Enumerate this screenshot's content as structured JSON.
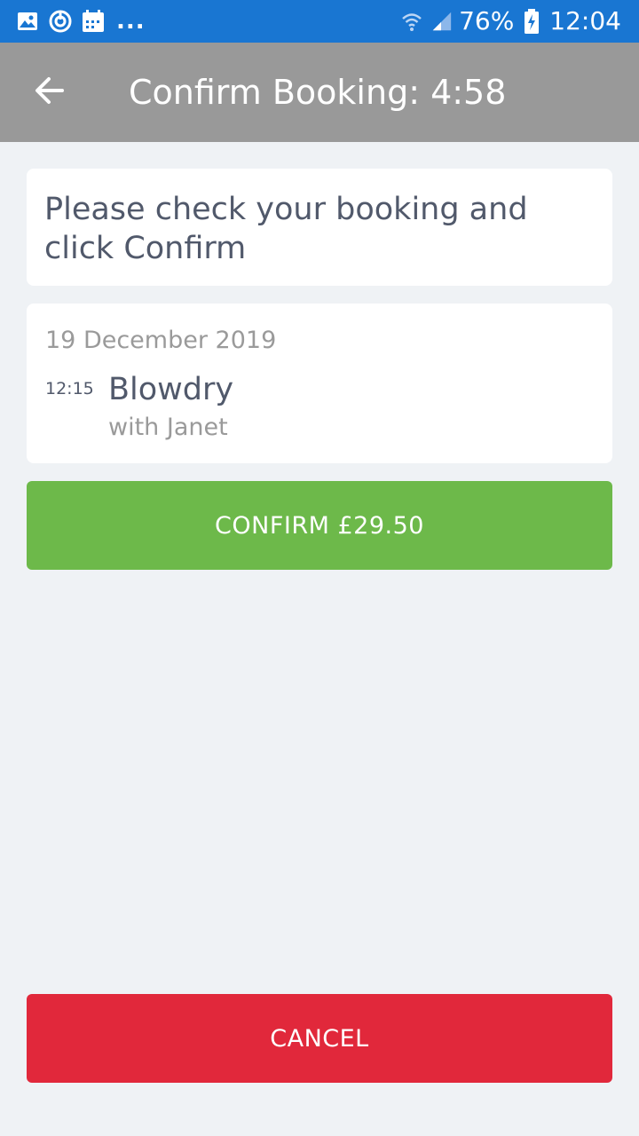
{
  "status_bar": {
    "left_icons": [
      "image-icon",
      "sync-icon",
      "calendar-icon"
    ],
    "overflow": "...",
    "battery": "76%",
    "time": "12:04",
    "color": "#1976d2"
  },
  "app_bar": {
    "title": "Confirm Booking: 4:58",
    "back_icon": "arrow-left-icon",
    "color": "#999999"
  },
  "instruction": {
    "text": "Please check your booking and click Confirm"
  },
  "booking": {
    "date": "19 December 2019",
    "time": "12:15",
    "service": "Blowdry",
    "staff": "with Janet"
  },
  "actions": {
    "confirm_label": "CONFIRM £29.50",
    "confirm_color": "#6db94a",
    "cancel_label": "CANCEL",
    "cancel_color": "#e1283b"
  }
}
